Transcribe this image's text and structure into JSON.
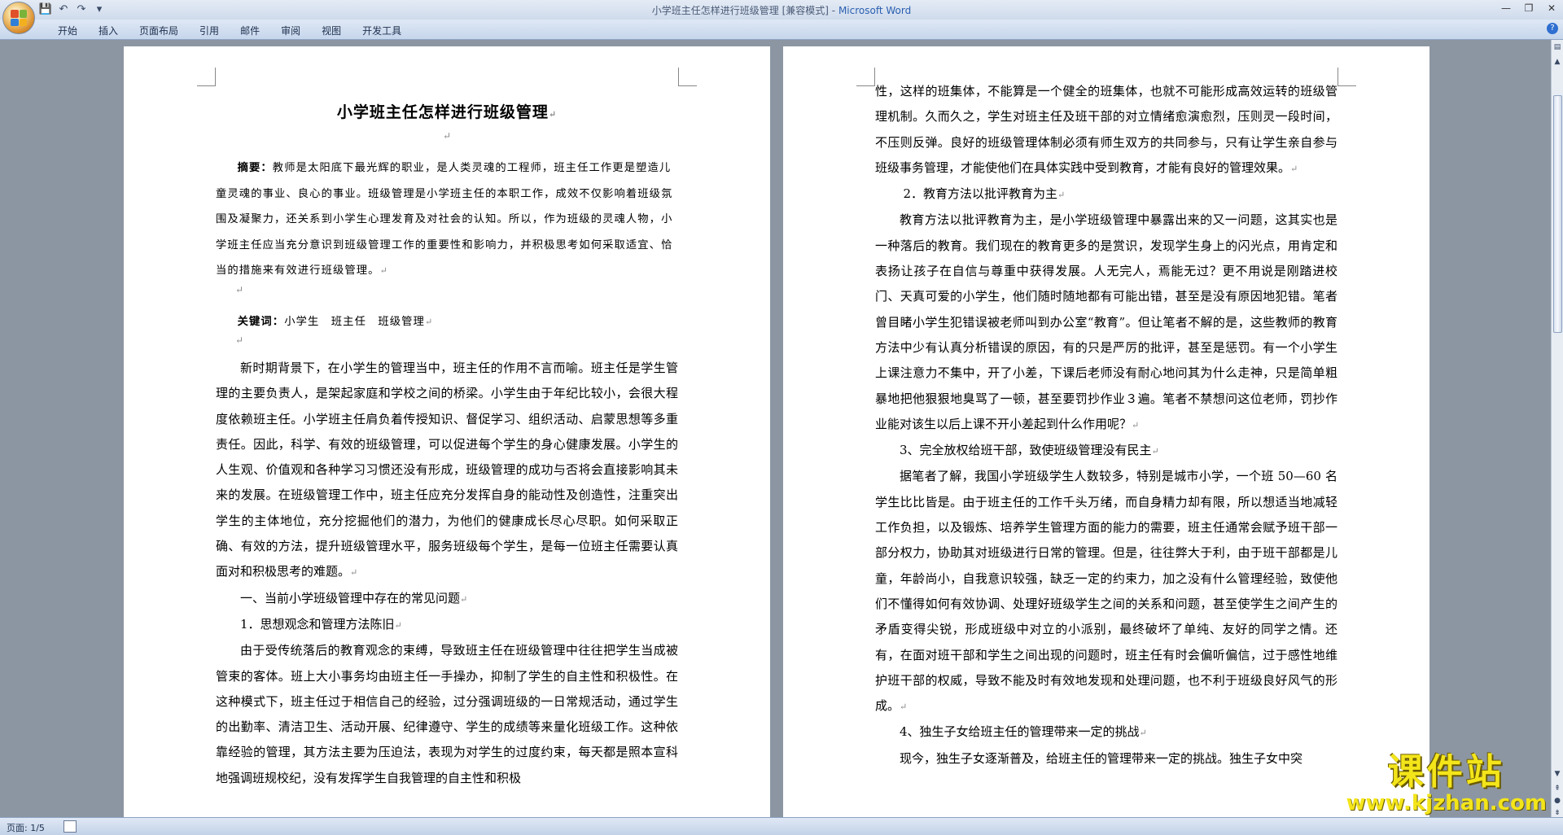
{
  "window": {
    "title": "小学班主任怎样进行班级管理 [兼容模式]",
    "app_name": "Microsoft Word",
    "separator": " - "
  },
  "quick_access": [
    {
      "icon": "save-icon",
      "glyph": "💾"
    },
    {
      "icon": "undo-icon",
      "glyph": "↶"
    },
    {
      "icon": "redo-icon",
      "glyph": "↷"
    },
    {
      "icon": "customize-icon",
      "glyph": "▾"
    }
  ],
  "window_controls": {
    "minimize": "—",
    "restore": "❐",
    "close": "✕"
  },
  "ribbon_tabs": [
    "开始",
    "插入",
    "页面布局",
    "引用",
    "邮件",
    "审阅",
    "视图",
    "开发工具"
  ],
  "colors": {
    "accent": "#2a5fb0",
    "watermark": "#f3e51a"
  },
  "left_page": {
    "title": "小学班主任怎样进行班级管理",
    "abstract_label": "摘要：",
    "abstract": "教师是太阳底下最光辉的职业，是人类灵魂的工程师，班主任工作更是塑造儿童灵魂的事业、良心的事业。班级管理是小学班主任的本职工作，成效不仅影响着班级氛围及凝聚力，还关系到小学生心理发育及对社会的认知。所以，作为班级的灵魂人物，小学班主任应当充分意识到班级管理工作的重要性和影响力，并积极思考如何采取适宜、恰当的措施来有效进行班级管理。",
    "keywords_label": "关键词：",
    "keywords": "小学生　班主任　班级管理",
    "intro": "新时期背景下，在小学生的管理当中，班主任的作用不言而喻。班主任是学生管理的主要负责人，是架起家庭和学校之间的桥梁。小学生由于年纪比较小，会很大程度依赖班主任。小学班主任肩负着传授知识、督促学习、组织活动、启蒙思想等多重责任。因此，科学、有效的班级管理，可以促进每个学生的身心健康发展。小学生的人生观、价值观和各种学习习惯还没有形成，班级管理的成功与否将会直接影响其未来的发展。在班级管理工作中，班主任应充分发挥自身的能动性及创造性，注重突出学生的主体地位，充分挖掘他们的潜力，为他们的健康成长尽心尽职。如何采取正确、有效的方法，提升班级管理水平，服务班级每个学生，是每一位班主任需要认真面对和积极思考的难题。",
    "heading1": "一、当前小学班级管理中存在的常见问题",
    "heading2": "1．思想观念和管理方法陈旧",
    "para2": "由于受传统落后的教育观念的束缚，导致班主任在班级管理中往往把学生当成被管束的客体。班上大小事务均由班主任一手操办，抑制了学生的自主性和积极性。在这种模式下，班主任过于相信自己的经验，过分强调班级的一日常规活动，通过学生的出勤率、清洁卫生、活动开展、纪律遵守、学生的成绩等来量化班级工作。这种依靠经验的管理，其方法主要为压迫法，表现为对学生的过度约束，每天都是照本宣科地强调班规校纪，没有发挥学生自我管理的自主性和积极"
  },
  "right_page": {
    "para1": "性，这样的班集体，不能算是一个健全的班集体，也就不可能形成高效运转的班级管理机制。久而久之，学生对班主任及班干部的对立情绪愈演愈烈，压则灵一段时间，不压则反弹。良好的班级管理体制必须有师生双方的共同参与，只有让学生亲自参与班级事务管理，才能使他们在具体实践中受到教育，才能有良好的管理效果。",
    "heading1": "2．教育方法以批评教育为主",
    "para2": "教育方法以批评教育为主，是小学班级管理中暴露出来的又一问题，这其实也是一种落后的教育。我们现在的教育更多的是赏识，发现学生身上的闪光点，用肯定和表扬让孩子在自信与尊重中获得发展。人无完人，焉能无过？更不用说是刚踏进校门、天真可爱的小学生，他们随时随地都有可能出错，甚至是没有原因地犯错。笔者曾目睹小学生犯错误被老师叫到办公室“教育”。但让笔者不解的是，这些教师的教育方法中少有认真分析错误的原因，有的只是严厉的批评，甚至是惩罚。有一个小学生上课注意力不集中，开了小差，下课后老师没有耐心地问其为什么走神，只是简单粗暴地把他狠狠地臭骂了一顿，甚至要罚抄作业３遍。笔者不禁想问这位老师，罚抄作业能对该生以后上课不开小差起到什么作用呢？",
    "heading2": "3、完全放权给班干部，致使班级管理没有民主",
    "para3": "据笔者了解，我国小学班级学生人数较多，特别是城市小学，一个班 50—60 名学生比比皆是。由于班主任的工作千头万绪，而自身精力却有限，所以想适当地减轻工作负担，以及锻炼、培养学生管理方面的能力的需要，班主任通常会赋予班干部一部分权力，协助其对班级进行日常的管理。但是，往往弊大于利，由于班干部都是儿童，年龄尚小，自我意识较强，缺乏一定的约束力，加之没有什么管理经验，致使他们不懂得如何有效协调、处理好班级学生之间的关系和问题，甚至使学生之间产生的矛盾变得尖锐，形成班级中对立的小派别，最终破坏了单纯、友好的同学之情。还有，在面对班干部和学生之间出现的问题时，班主任有时会偏听偏信，过于感性地维护班干部的权威，导致不能及时有效地发现和处理问题，也不利于班级良好风气的形成。",
    "heading3": "4、独生子女给班主任的管理带来一定的挑战",
    "para4": "现今，独生子女逐渐普及，给班主任的管理带来一定的挑战。独生子女中突"
  },
  "status_bar": {
    "page_info": "页面: 1/5"
  },
  "watermark": {
    "text": "课件站",
    "url": "www.kjzhan.com"
  }
}
